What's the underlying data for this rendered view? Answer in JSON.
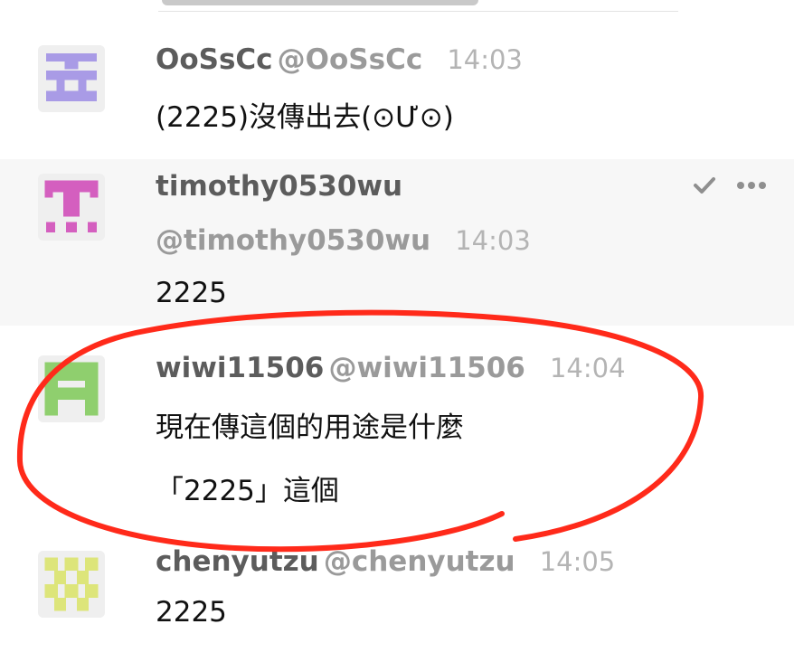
{
  "colors": {
    "accent_annotation": "#ff2a1a",
    "username": "#5c5c5c",
    "handle": "#9a9a9a",
    "timestamp": "#b4b4b4",
    "hover_bg": "#f7f7f7"
  },
  "messages": [
    {
      "author": "OoSsCc",
      "handle": "@OoSsCc",
      "time": "14:03",
      "lines": [
        "(2225)沒傳出去(⊙Ư⊙)"
      ],
      "avatar_color": "#a99be6"
    },
    {
      "author": "timothy0530wu",
      "handle": "@timothy0530wu",
      "time": "14:03",
      "lines": [
        "2225"
      ],
      "avatar_color": "#d45fbf",
      "hovered": true,
      "action_icons": [
        "check-icon",
        "more-icon"
      ]
    },
    {
      "author": "wiwi11506",
      "handle": "@wiwi11506",
      "time": "14:04",
      "lines": [
        "現在傳這個的用途是什麼",
        "「2225」這個"
      ],
      "avatar_color": "#8fcf6e",
      "annotated": true
    },
    {
      "author": "chenyutzu",
      "handle": "@chenyutzu",
      "time": "14:05",
      "lines": [
        "2225"
      ],
      "avatar_color": "#dde57a"
    }
  ]
}
